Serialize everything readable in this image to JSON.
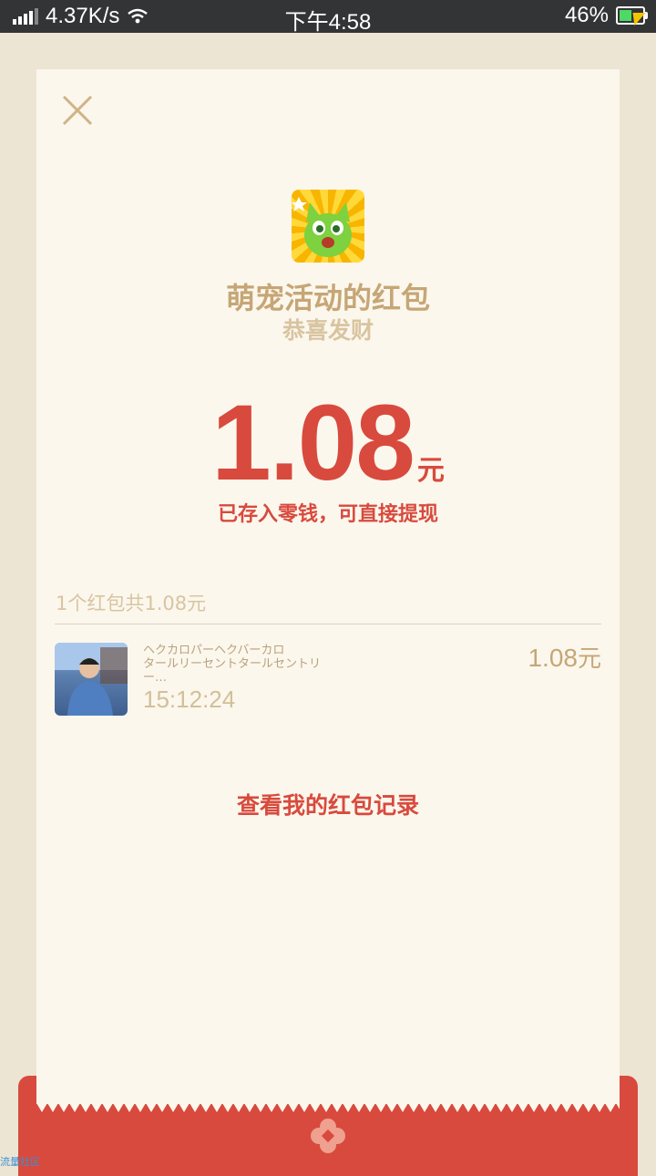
{
  "status_bar": {
    "network_speed": "4.37K/s",
    "time": "下午4:58",
    "battery": "46%"
  },
  "packet": {
    "title": "萌宠活动的红包",
    "greeting": "恭喜发财",
    "amount": "1.08",
    "unit": "元",
    "saved_note": "已存入零钱，可直接提现"
  },
  "summary": "1个红包共1.08元",
  "records": [
    {
      "name_line1": "ヘクカロパーヘクバーカロ",
      "name_line2": "タールリーセントタールセントリー…",
      "time": "15:12:24",
      "amount": "1.08",
      "unit": "元"
    }
  ],
  "view_records_label": "查看我的红包记录",
  "watermark": "流量社区",
  "colors": {
    "accent_red": "#d84a3d",
    "gold": "#c6a676",
    "card_bg": "#fbf7ed"
  }
}
